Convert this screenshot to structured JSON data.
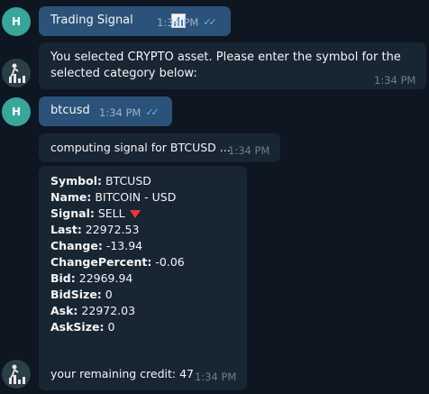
{
  "messages": [
    {
      "text": "Trading Signal",
      "time": "1:34 PM"
    },
    {
      "text": "You selected CRYPTO asset. Please enter the symbol for the selected category below:",
      "time": "1:34 PM"
    },
    {
      "text": "btcusd",
      "time": "1:34 PM"
    },
    {
      "text": "computing signal for BTCUSD ...",
      "time": "1:34 PM"
    },
    {
      "fields": [
        {
          "label": "Symbol:",
          "value": " BTCUSD"
        },
        {
          "label": "Name:",
          "value": " BITCOIN - USD"
        },
        {
          "label": "Signal:",
          "value": " SELL"
        },
        {
          "label": "Last:",
          "value": " 22972.53"
        },
        {
          "label": "Change:",
          "value": " -13.94"
        },
        {
          "label": "ChangePercent:",
          "value": " -0.06"
        },
        {
          "label": "Bid:",
          "value": " 22969.94"
        },
        {
          "label": "BidSize:",
          "value": " 0"
        },
        {
          "label": "Ask:",
          "value": " 22972.03"
        },
        {
          "label": "AskSize:",
          "value": " 0"
        }
      ],
      "credit": "your remaining credit: 47",
      "time": "1:34 PM"
    }
  ],
  "user_initial": "H",
  "colors": {
    "background": "#0e1621",
    "outgoing_bubble": "#2b5278",
    "incoming_bubble": "#182533",
    "read_ticks": "#6cb5f5",
    "sell_indicator": "#e53935"
  }
}
